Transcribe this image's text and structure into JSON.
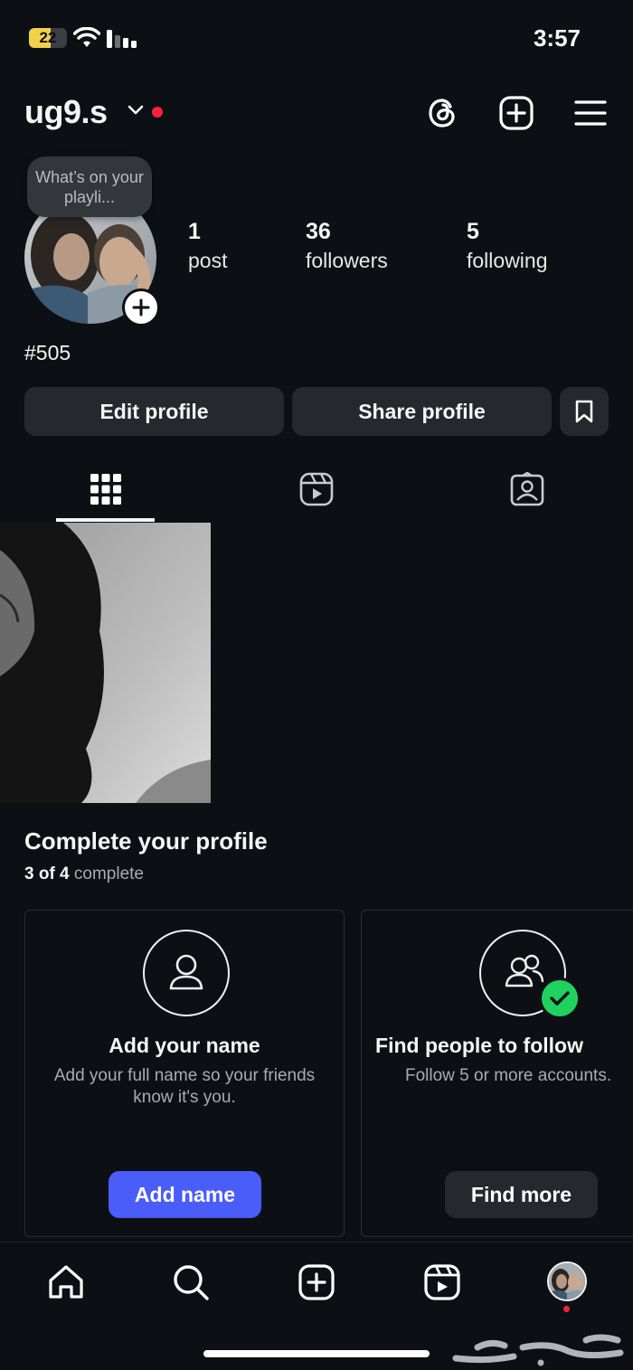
{
  "status_bar": {
    "battery": "22",
    "time": "3:57"
  },
  "header": {
    "username": "ug9.s",
    "icons": [
      "threads-icon",
      "plus-square-icon",
      "hamburger-menu-icon"
    ]
  },
  "profile": {
    "note": "What’s on your playli...",
    "stats": [
      {
        "value": "1",
        "label": "post"
      },
      {
        "value": "36",
        "label": "followers"
      },
      {
        "value": "5",
        "label": "following"
      }
    ],
    "bio": "#505"
  },
  "actions": {
    "edit_profile": "Edit profile",
    "share_profile": "Share profile"
  },
  "tabs": [
    "grid-icon",
    "reels-icon",
    "tagged-icon"
  ],
  "complete_profile": {
    "title": "Complete your profile",
    "progress_count": "3 of 4",
    "progress_word": "complete",
    "cards": [
      {
        "title": "Add your name",
        "subtitle": "Add your full name so your friends know it's you.",
        "button": "Add name",
        "done": false
      },
      {
        "title": "Find people to follow",
        "subtitle": "Follow 5 or more accounts.",
        "button": "Find more",
        "done": true
      }
    ]
  },
  "bottom_nav": [
    "home-icon",
    "search-icon",
    "create-icon",
    "reels-icon",
    "profile-avatar"
  ],
  "watermark": "حراج",
  "colors": {
    "background": "#0c1014",
    "button": "#25292e",
    "primary": "#4a5df9",
    "red_dot": "#ff1f3d",
    "check": "#1fd25f"
  }
}
